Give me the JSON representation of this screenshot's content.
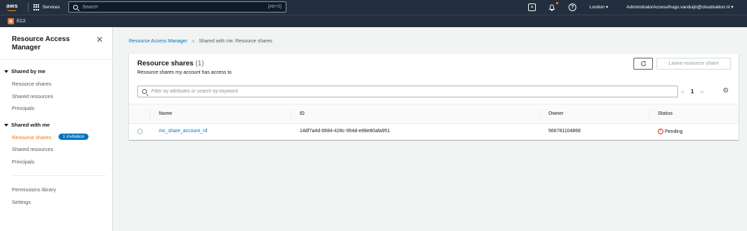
{
  "topnav": {
    "logo_text": "aws",
    "services_label": "Services",
    "search_placeholder": "Search",
    "search_shortcut": "[Alt+S]",
    "region": "London",
    "account": "AdministratorAccess/hugo.vanduijn@cloudnation.nl",
    "icons": [
      "cloudshell-icon",
      "bell-icon",
      "help-icon"
    ]
  },
  "favorites": {
    "ec2_label": "EC2"
  },
  "sidebar": {
    "title": "Resource Access Manager",
    "sections": [
      {
        "label": "Shared by me",
        "items": [
          {
            "label": "Resource shares"
          },
          {
            "label": "Shared resources"
          },
          {
            "label": "Principals"
          }
        ]
      },
      {
        "label": "Shared with me",
        "items": [
          {
            "label": "Resource shares",
            "active": true,
            "badge": "1 invitation"
          },
          {
            "label": "Shared resources"
          },
          {
            "label": "Principals"
          }
        ]
      }
    ],
    "extra": [
      {
        "label": "Permissions library"
      },
      {
        "label": "Settings"
      }
    ]
  },
  "breadcrumb": {
    "root": "Resource Access Manager",
    "current": "Shared with me: Resource shares"
  },
  "panel": {
    "title": "Resource shares",
    "count": "(1)",
    "description": "Resource shares my account has access to",
    "leave_button": "Leave resource share",
    "filter_placeholder": "Filter by attributes or search by keyword",
    "page": "1",
    "columns": [
      "Name",
      "ID",
      "Owner",
      "Status"
    ],
    "rows": [
      {
        "name": "mc_share_account_rd",
        "id": "14df7a4d-0684-428c-954d-e88e80afa951",
        "owner": "566781104868",
        "status": "Pending"
      }
    ]
  },
  "colors": {
    "nav_bg": "#232f3e",
    "link": "#0073bb",
    "active": "#ec7211",
    "pending": "#d13212"
  }
}
